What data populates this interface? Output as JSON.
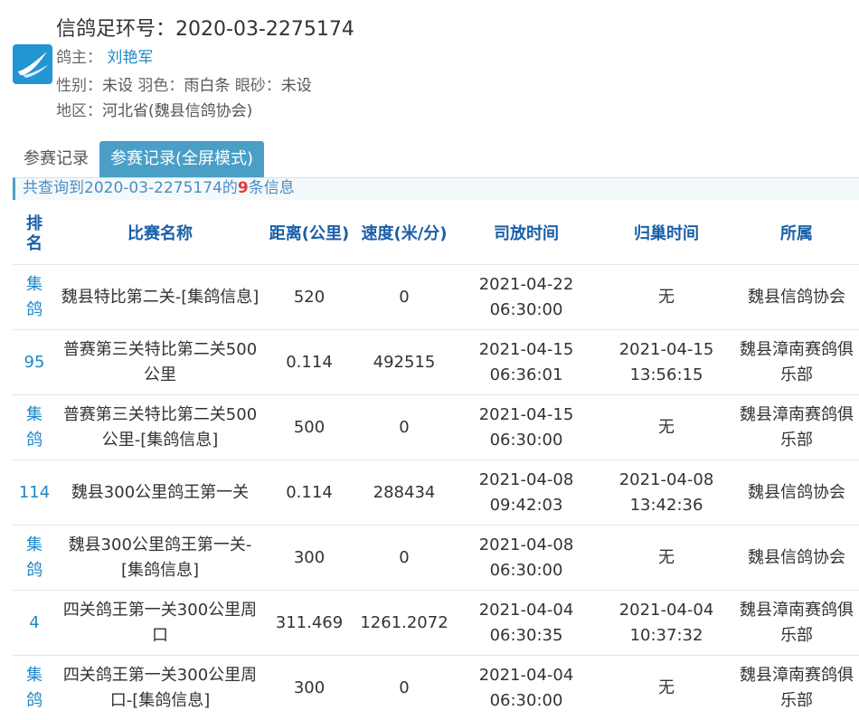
{
  "header": {
    "ring_label": "信鸽足环号：",
    "ring_number": "2020-03-2275174",
    "owner_label": "鸽主：",
    "owner_name": "刘艳军",
    "gender_label": "性别：",
    "gender_value": "未设",
    "feather_label": "羽色：",
    "feather_value": "雨白条",
    "eye_label": "眼砂：",
    "eye_value": "未设",
    "region_label": "地区：",
    "region_value": "河北省(魏县信鸽协会)",
    "logo_icon": "swallow-logo-icon",
    "logo_color": "#2196d3"
  },
  "tabs": [
    {
      "label": "参赛记录",
      "active": false
    },
    {
      "label": "参赛记录(全屏模式)",
      "active": true
    }
  ],
  "summary": {
    "prefix": "共查询到2020-03-2275174的",
    "count": "9",
    "suffix": "条信息"
  },
  "table": {
    "columns": [
      "排名",
      "比赛名称",
      "距离(公里)",
      "速度(米/分)",
      "司放时间",
      "归巢时间",
      "所属"
    ],
    "rows": [
      [
        "集鸽",
        "魏县特比第二关-[集鸽信息]",
        "520",
        "0",
        "2021-04-22 06:30:00",
        "无",
        "魏县信鸽协会"
      ],
      [
        "95",
        "普赛第三关特比第二关500公里",
        "0.114",
        "492515",
        "2021-04-15 06:36:01",
        "2021-04-15 13:56:15",
        "魏县漳南赛鸽俱乐部"
      ],
      [
        "集鸽",
        "普赛第三关特比第二关500公里-[集鸽信息]",
        "500",
        "0",
        "2021-04-15 06:30:00",
        "无",
        "魏县漳南赛鸽俱乐部"
      ],
      [
        "114",
        "魏县300公里鸽王第一关",
        "0.114",
        "288434",
        "2021-04-08 09:42:03",
        "2021-04-08 13:42:36",
        "魏县信鸽协会"
      ],
      [
        "集鸽",
        "魏县300公里鸽王第一关-[集鸽信息]",
        "300",
        "0",
        "2021-04-08 06:30:00",
        "无",
        "魏县信鸽协会"
      ],
      [
        "4",
        "四关鸽王第一关300公里周口",
        "311.469",
        "1261.2072",
        "2021-04-04 06:30:35",
        "2021-04-04 10:37:32",
        "魏县漳南赛鸽俱乐部"
      ],
      [
        "集鸽",
        "四关鸽王第一关300公里周口-[集鸽信息]",
        "300",
        "0",
        "2021-04-04 06:30:00",
        "无",
        "魏县漳南赛鸽俱乐部"
      ]
    ]
  },
  "colors": {
    "accent": "#4a9fc7",
    "header_text": "#1a5fa8",
    "link": "#1e88c8",
    "count": "#e53935"
  }
}
